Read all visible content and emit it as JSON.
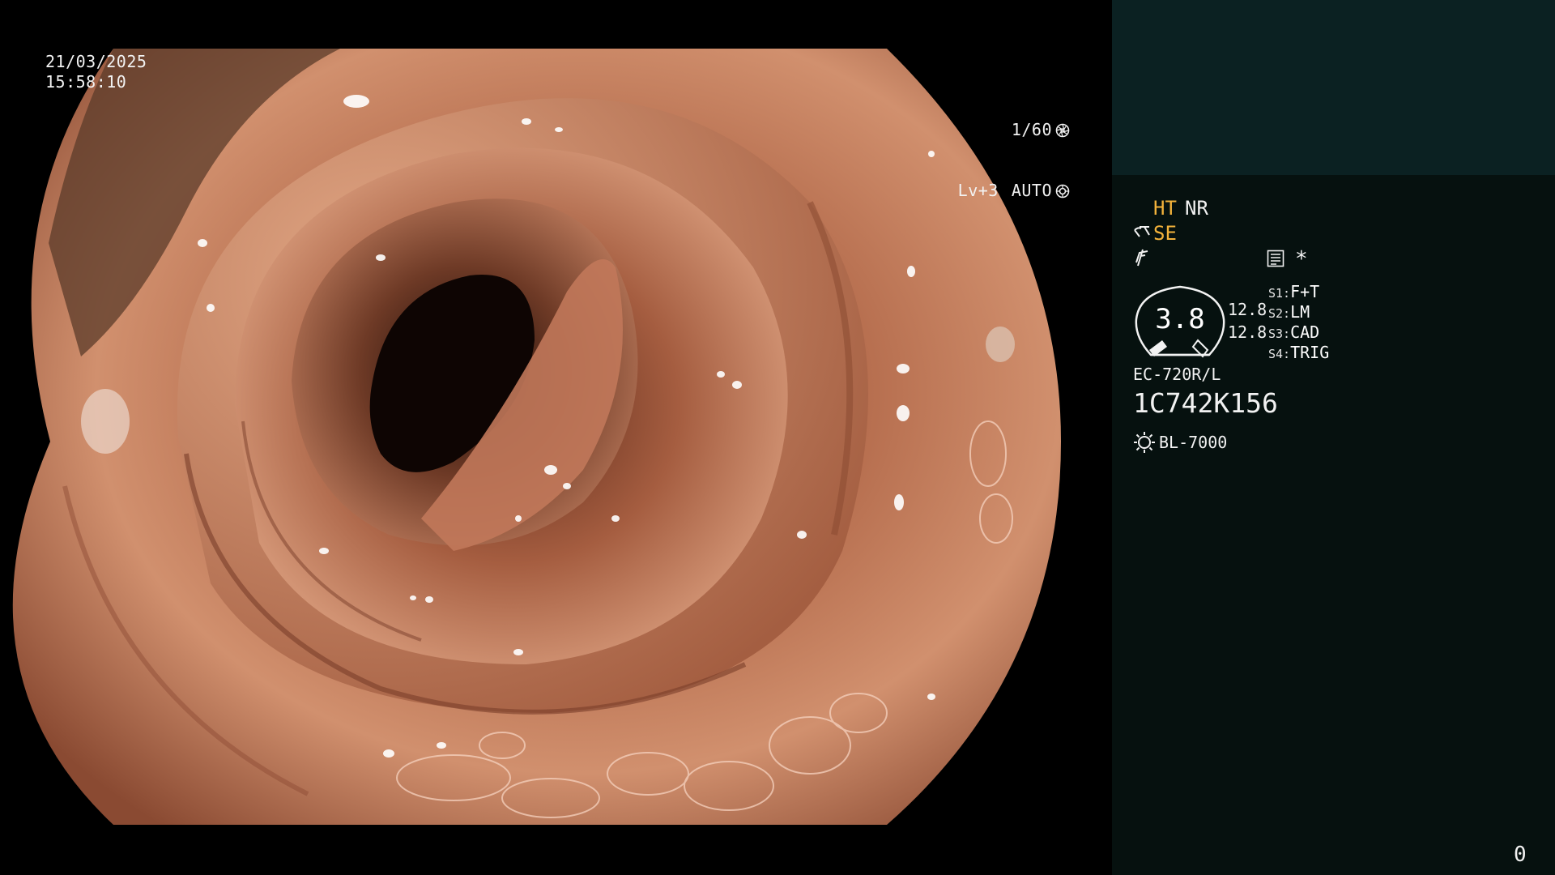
{
  "overlay": {
    "date": "21/03/2025",
    "time": "15:58:10",
    "shutter": "1/60",
    "level": "Lv+3",
    "mode": "AUTO"
  },
  "panel": {
    "ht_label": "HT",
    "nr_label": "NR",
    "se_label": "SE",
    "star_label": "*",
    "gauge_value": "3.8",
    "value_a": "12.8",
    "value_b": "12.8",
    "switches": [
      {
        "key": "S1:",
        "value": "F+T"
      },
      {
        "key": "S2:",
        "value": "LM"
      },
      {
        "key": "S3:",
        "value": "CAD"
      },
      {
        "key": "S4:",
        "value": "TRIG"
      }
    ],
    "scope_model": "EC-720R/L",
    "serial": "1C742K156",
    "light_source": "BL-7000",
    "counter": "0"
  },
  "colors": {
    "panel_bg": "#06110f",
    "panel_top_bg": "#0b2122",
    "accent_yellow": "#f3b23b",
    "mucosa": "#c98462"
  },
  "icons": {
    "shutter": "aperture-icon",
    "mode": "iris-icon",
    "se": "scope-tip-icon",
    "filter": "filter-icon",
    "menu": "settings-list-icon",
    "light": "light-source-icon"
  }
}
